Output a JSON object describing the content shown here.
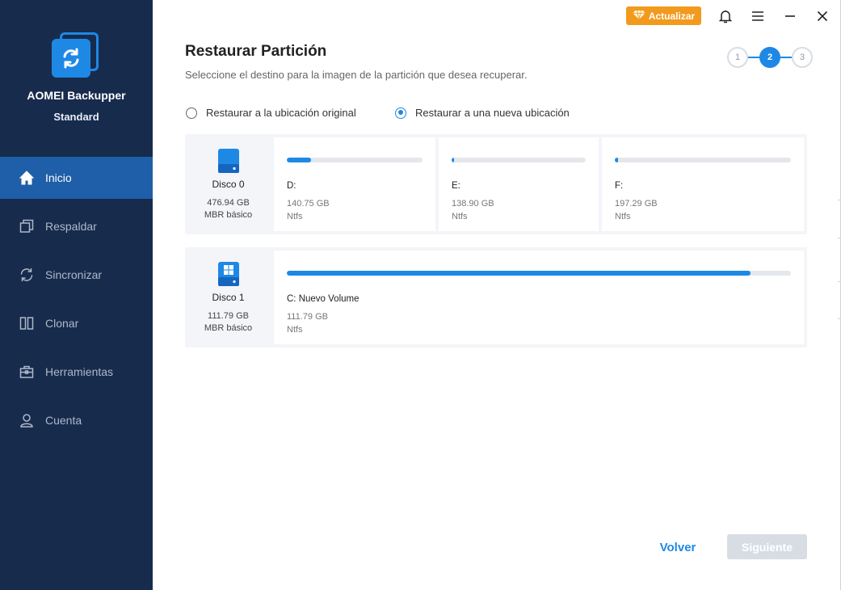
{
  "app": {
    "name": "AOMEI Backupper",
    "edition": "Standard",
    "accent": "#1e88e5",
    "sidebar_bg": "#172b4d"
  },
  "sidebar": {
    "items": [
      {
        "label": "Inicio",
        "icon": "home-icon",
        "active": true
      },
      {
        "label": "Respaldar",
        "icon": "backup-icon",
        "active": false
      },
      {
        "label": "Sincronizar",
        "icon": "sync-icon",
        "active": false
      },
      {
        "label": "Clonar",
        "icon": "clone-icon",
        "active": false
      },
      {
        "label": "Herramientas",
        "icon": "toolbox-icon",
        "active": false
      },
      {
        "label": "Cuenta",
        "icon": "user-icon",
        "active": false
      }
    ]
  },
  "topbar": {
    "upgrade_label": "Actualizar",
    "upgrade_color": "#f29a1d"
  },
  "main": {
    "title": "Restaurar Partición",
    "subtitle": "Seleccione el destino para la imagen de la partición que desea recuperar.",
    "steps": [
      "1",
      "2",
      "3"
    ],
    "current_step": 2,
    "options": [
      {
        "label": "Restaurar a la ubicación original",
        "selected": false
      },
      {
        "label": "Restaurar a una nueva ubicación",
        "selected": true
      }
    ],
    "disks": [
      {
        "name": "Disco 0",
        "size": "476.94 GB",
        "type": "MBR básico",
        "partitions": [
          {
            "label": "D:",
            "size": "140.75 GB",
            "fs": "Ntfs",
            "used_fraction": 0.18
          },
          {
            "label": "E:",
            "size": "138.90 GB",
            "fs": "Ntfs",
            "used_fraction": 0.02
          },
          {
            "label": "F:",
            "size": "197.29 GB",
            "fs": "Ntfs",
            "used_fraction": 0.02
          }
        ]
      },
      {
        "name": "Disco 1",
        "size": "111.79 GB",
        "type": "MBR básico",
        "partitions": [
          {
            "label": "C: Nuevo Volume",
            "size": "111.79 GB",
            "fs": "Ntfs",
            "used_fraction": 0.92
          }
        ]
      }
    ],
    "back_label": "Volver",
    "next_label": "Siguiente"
  }
}
